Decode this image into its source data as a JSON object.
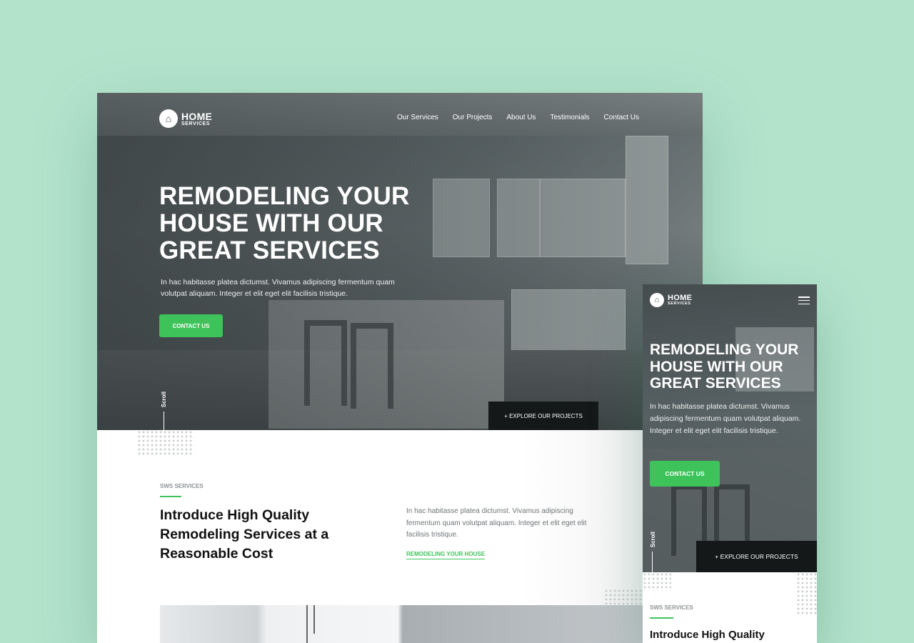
{
  "brand": {
    "name": "HOME",
    "tagline": "SERVICES"
  },
  "nav": [
    "Our Services",
    "Our Projects",
    "About Us",
    "Testimonials",
    "Contact Us"
  ],
  "hero": {
    "title": "REMODELING YOUR\nHOUSE WITH OUR\nGREAT SERVICES",
    "description": "In hac habitasse platea dictumst. Vivamus adipiscing fermentum quam volutpat aliquam. Integer et elit eget elit facilisis tristique.",
    "cta": "CONTACT US",
    "scroll": "Scroll",
    "explore": "+ EXPLORE OUR PROJECTS"
  },
  "services": {
    "eyebrow": "SWS SERVICES",
    "title": "Introduce High Quality\nRemodeling Services at a\nReasonable Cost",
    "description": "In hac habitasse platea dictumst. Vivamus adipiscing fermentum quam volutpat aliquam. Integer et elit eget elit facilisis tristique.",
    "link": "REMODELING YOUR HOUSE"
  },
  "mobile": {
    "title": "REMODELING YOUR\nHOUSE WITH OUR\nGREAT SERVICES",
    "services_title": "Introduce High Quality"
  },
  "colors": {
    "accent": "#3ec35b",
    "background": "#b4e3cc",
    "dark": "#151819"
  },
  "icons": {
    "logo": "house-icon",
    "menu": "hamburger-icon"
  }
}
